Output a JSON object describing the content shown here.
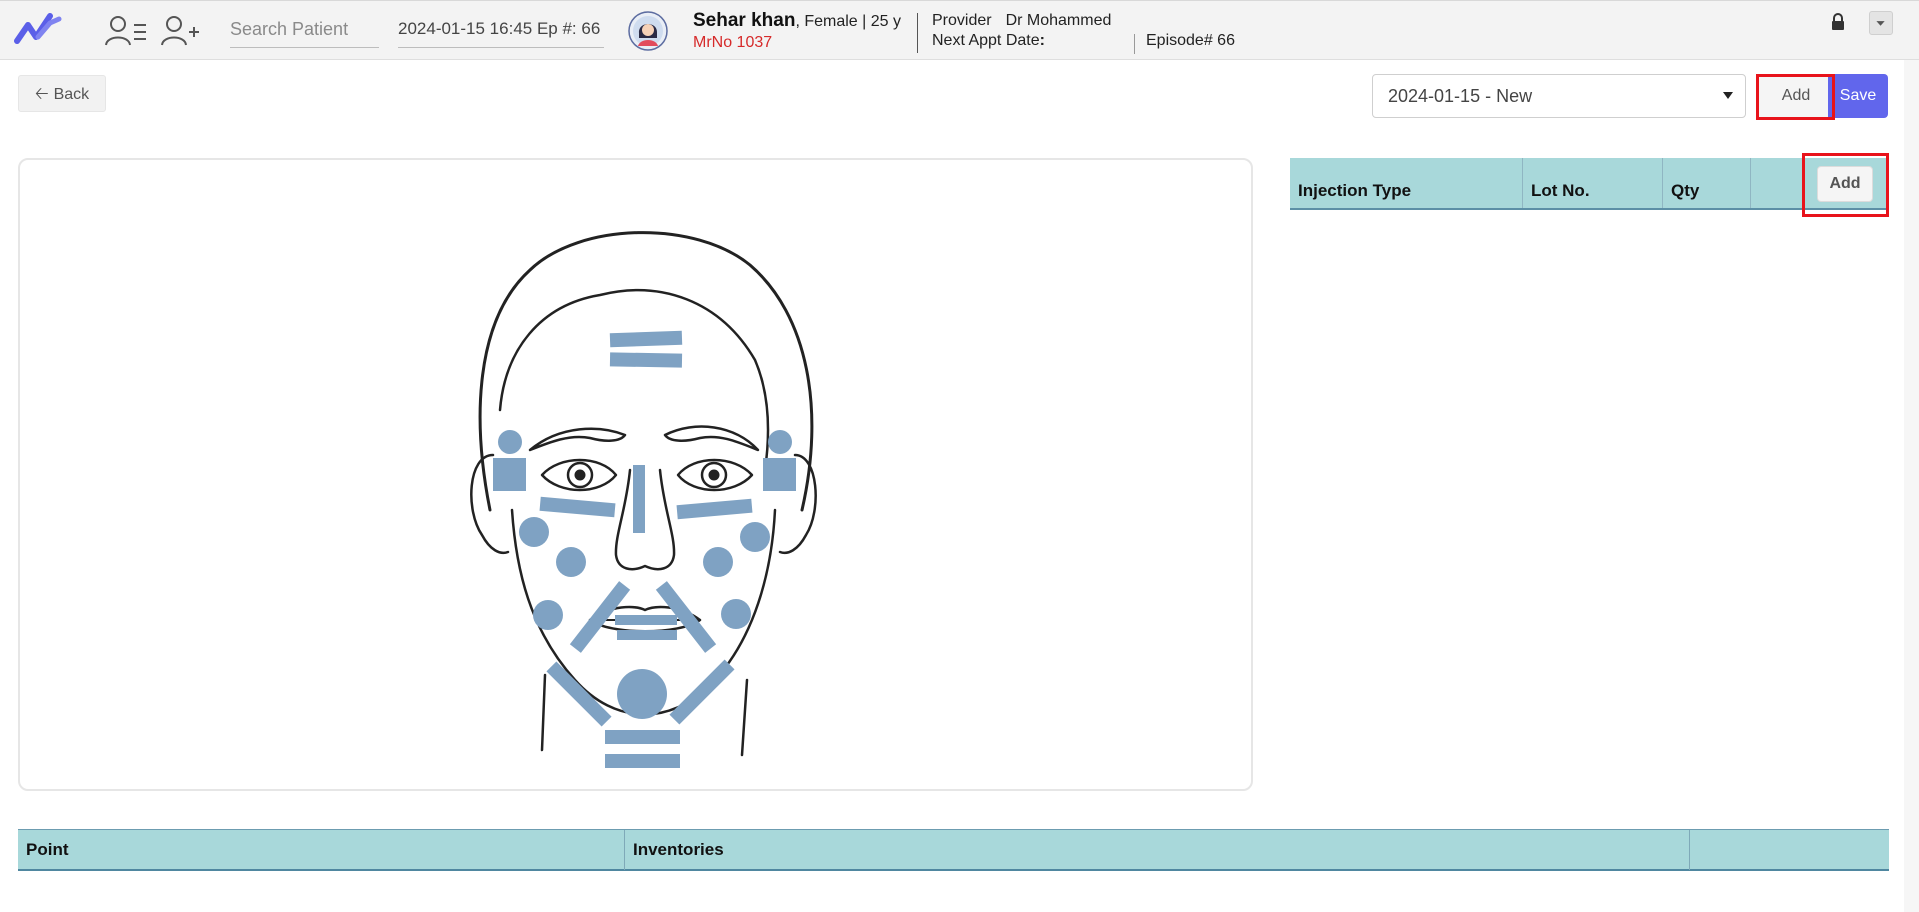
{
  "header": {
    "search_placeholder": "Search Patient",
    "episode_selector": "2024-01-15 16:45 Ep #: 66",
    "patient": {
      "name": "Sehar khan",
      "details": ", Female | 25 y",
      "mrno": "MrNo 1037"
    },
    "provider_label": "Provider",
    "provider_name": "Dr Mohammed",
    "next_appt_label": "Next Appt Date",
    "next_appt_colon": ":",
    "episode_number": "Episode# 66"
  },
  "toolbar": {
    "back_label": "Back",
    "visit_select_value": "2024-01-15 - New",
    "add_label": "Add",
    "save_label": "Save"
  },
  "injection_table": {
    "columns": [
      "Injection Type",
      "Lot No.",
      "Qty",
      ""
    ],
    "add_label": "Add"
  },
  "points_table": {
    "columns": [
      "Point",
      "Inventories",
      ""
    ]
  },
  "colors": {
    "accent": "#6166ec",
    "table_header": "#a8d8da",
    "injection_marker": "#7fa2c3",
    "highlight": "#e8131b",
    "mrno_text": "#d62a2a"
  },
  "icons": [
    "app-logo-icon",
    "patient-list-icon",
    "add-patient-icon",
    "avatar-icon",
    "lock-icon",
    "chevron-down-icon",
    "arrow-left-icon"
  ]
}
